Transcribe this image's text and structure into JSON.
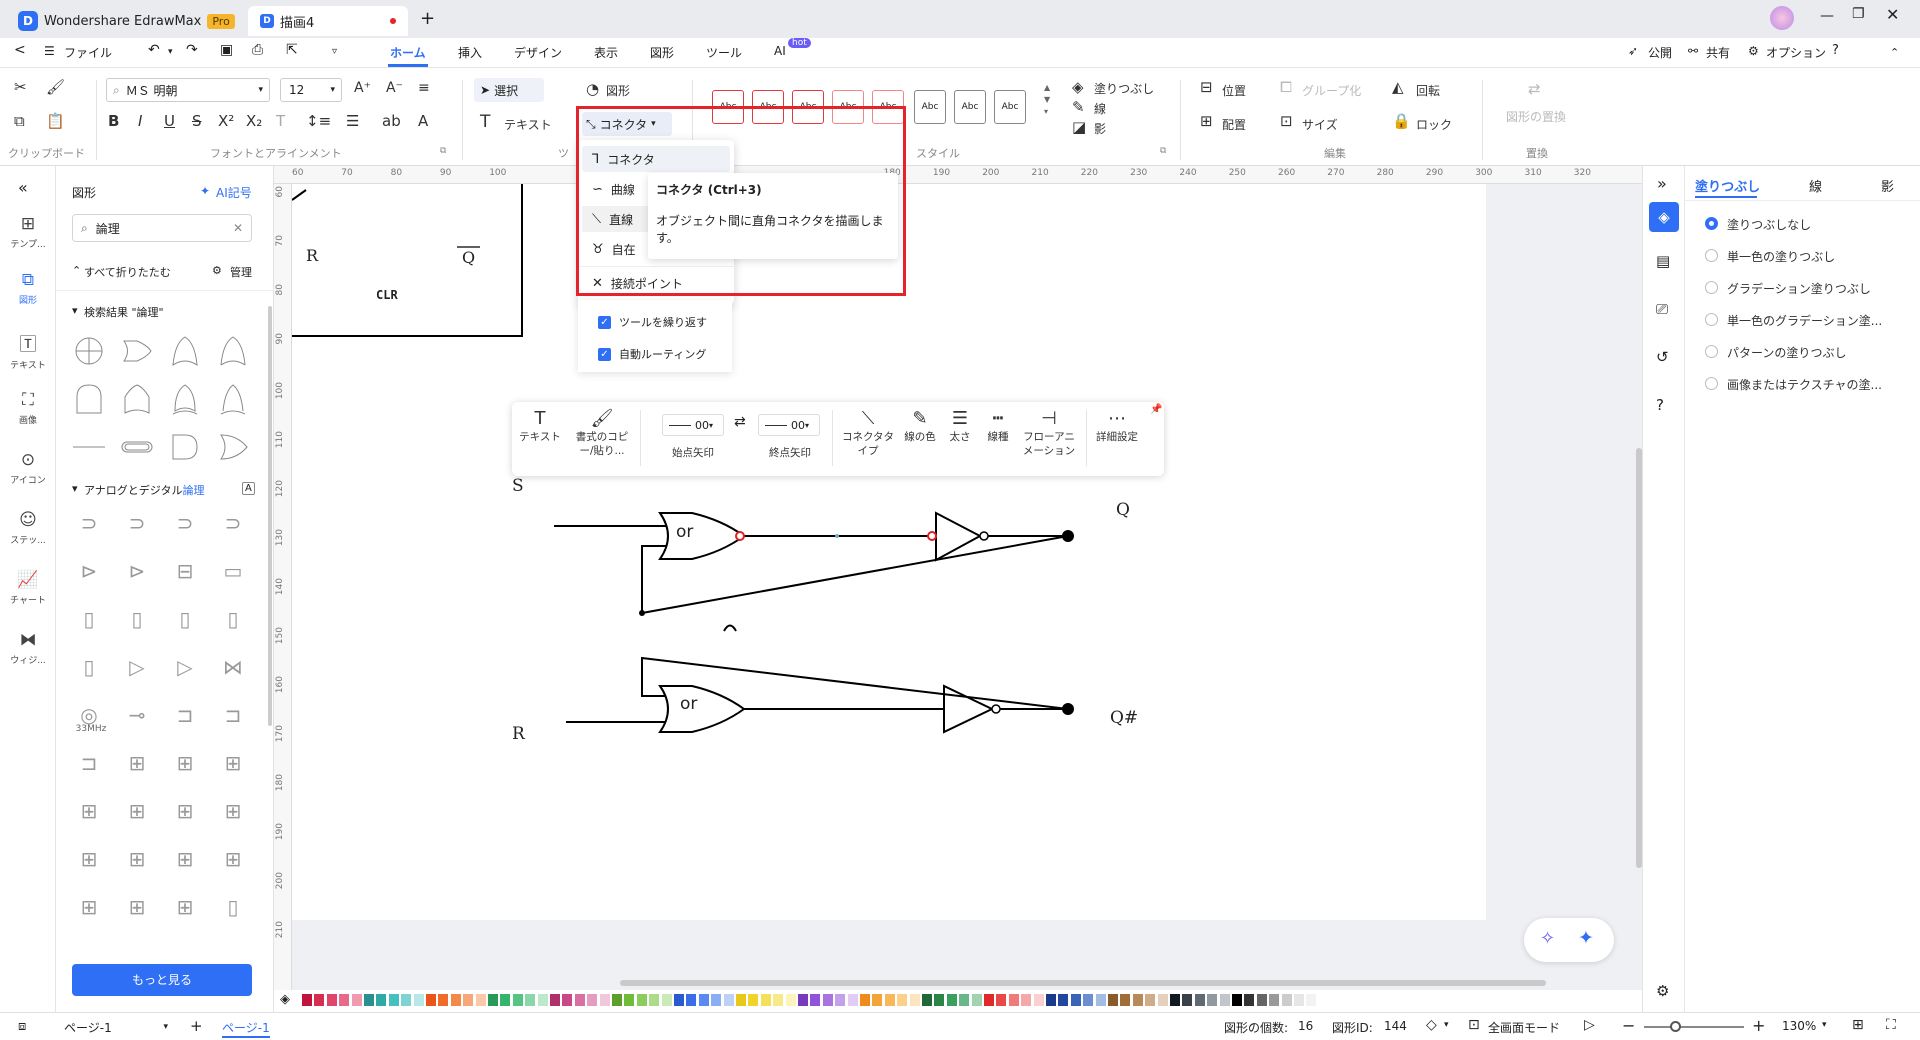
{
  "titlebar": {
    "app_name": "Wondershare EdrawMax",
    "pro_badge": "Pro",
    "doc_tab": "描画4",
    "new_tab": "+"
  },
  "menubar": {
    "back": "<",
    "file": "ファイル",
    "tabs": [
      "ホーム",
      "挿入",
      "デザイン",
      "表示",
      "図形",
      "ツール",
      "AI"
    ],
    "ai_badge": "hot",
    "publish": "公開",
    "share": "共有",
    "options": "オプション"
  },
  "ribbon": {
    "font_name": "ＭＳ 明朝",
    "font_size": "12",
    "select": "選択",
    "shape": "図形",
    "text": "テキスト",
    "connector": "コネクタ",
    "fill": "塗りつぶし",
    "line": "線",
    "shadow": "影",
    "position": "位置",
    "group": "グループ化",
    "rotate": "回転",
    "align": "配置",
    "size": "サイズ",
    "lock": "ロック",
    "replace_shape": "図形の置換",
    "style_sample": "Abc",
    "labels": {
      "clipboard": "クリップボード",
      "font": "フォントとアラインメント",
      "tools": "ツ",
      "style": "スタイル",
      "edit": "編集",
      "replace": "置換"
    }
  },
  "iconbar": [
    {
      "label": "テンプ..."
    },
    {
      "label": "図形"
    },
    {
      "label": "テキスト"
    },
    {
      "label": "画像"
    },
    {
      "label": "アイコン"
    },
    {
      "label": "ステッ..."
    },
    {
      "label": "チャート"
    },
    {
      "label": "ウィジ..."
    }
  ],
  "shapes_panel": {
    "title": "図形",
    "ai_label": "AI記号",
    "search_value": "論理",
    "collapse_all": "すべて折りたたむ",
    "manage": "管理",
    "section_search": "検索結果 \"論理\"",
    "section_analog_prefix": "アナログとデジタル",
    "section_analog_highlight": "論理",
    "more_button": "もっと見る",
    "freq_label": "33MHz"
  },
  "ruler_h": [
    "60",
    "70",
    "80",
    "90",
    "100",
    "",
    "",
    "",
    "",
    "",
    "",
    "",
    "180",
    "190",
    "200",
    "210",
    "220",
    "230",
    "240",
    "250",
    "260",
    "270",
    "280",
    "290",
    "300",
    "310",
    "320"
  ],
  "ruler_v": [
    "60",
    "70",
    "80",
    "90",
    "100",
    "110",
    "120",
    "130",
    "140",
    "150",
    "160",
    "170",
    "180",
    "190",
    "200",
    "210"
  ],
  "connector_menu": {
    "items": [
      "コネクタ",
      "曲線",
      "直線",
      "自在",
      "接続ポイント"
    ],
    "checks": [
      "ツールを繰り返す",
      "自動ルーティング"
    ]
  },
  "tooltip": {
    "title": "コネクタ (Ctrl+3)",
    "body": "オブジェクト間に直角コネクタを描画します。"
  },
  "floatbar": {
    "text": "テキスト",
    "format_copy": "書式のコピー/貼り...",
    "start_arrow": "始点矢印",
    "end_arrow": "終点矢印",
    "start_val": "00",
    "end_val": "00",
    "connector_type": "コネクタタイプ",
    "line_color": "線の色",
    "thickness": "太さ",
    "line_type": "線種",
    "flow_anim": "フローアニメーション",
    "detail": "詳細設定"
  },
  "diagram": {
    "R_top": "R",
    "Q_bar": "Q",
    "CLR": "CLR",
    "S": "S",
    "Q": "Q",
    "R": "R",
    "Q_hash": "Q#",
    "or1": "or",
    "or2": "or"
  },
  "rightpanel": {
    "tabs": [
      "塗りつぶし",
      "線",
      "影"
    ],
    "options": [
      "塗りつぶしなし",
      "単一色の塗りつぶし",
      "グラデーション塗りつぶし",
      "単一色のグラデーション塗...",
      "パターンの塗りつぶし",
      "画像またはテクスチャの塗..."
    ]
  },
  "statusbar": {
    "page_select": "ページ-1",
    "page_tab": "ページ-1",
    "shape_count_label": "図形の個数:",
    "shape_count": "16",
    "shape_id_label": "図形ID:",
    "shape_id": "144",
    "fullscreen": "全画面モード",
    "zoom": "130%"
  },
  "colors": {
    "accent": "#2f6ff5",
    "highlight": "#e5232a"
  }
}
